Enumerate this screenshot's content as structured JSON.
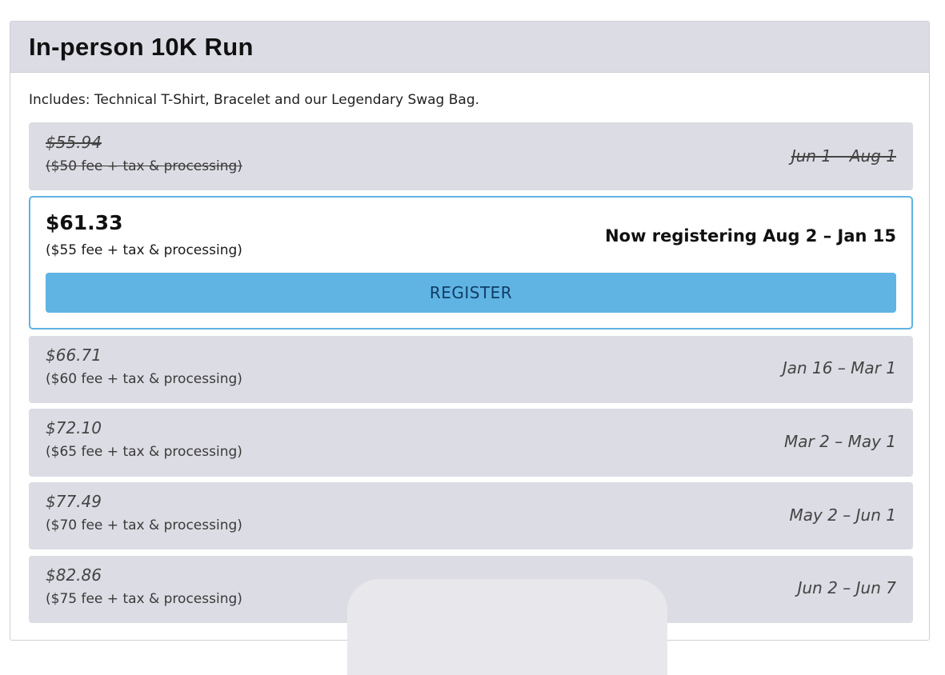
{
  "event": {
    "title": "In-person 10K Run",
    "includes": "Includes: Technical T-Shirt, Bracelet and our Legendary Swag Bag."
  },
  "tiers": [
    {
      "price": "$55.94",
      "fee": "($50 fee + tax & processing)",
      "dates": "Jun 1 – Aug 1",
      "status": "past"
    },
    {
      "price": "$61.33",
      "fee": "($55 fee + tax & processing)",
      "dates": "Now registering Aug 2 – Jan 15",
      "status": "current"
    },
    {
      "price": "$66.71",
      "fee": "($60 fee + tax & processing)",
      "dates": "Jan 16 – Mar 1",
      "status": "upcoming"
    },
    {
      "price": "$72.10",
      "fee": "($65 fee + tax & processing)",
      "dates": "Mar 2 – May 1",
      "status": "upcoming"
    },
    {
      "price": "$77.49",
      "fee": "($70 fee + tax & processing)",
      "dates": "May 2 – Jun 1",
      "status": "upcoming"
    },
    {
      "price": "$82.86",
      "fee": "($75 fee + tax & processing)",
      "dates": "Jun 2 – Jun 7",
      "status": "upcoming"
    }
  ],
  "register_button": {
    "label": "REGISTER"
  },
  "colors": {
    "header_bg": "#dcdce4",
    "tier_bg": "#dcdce4",
    "accent": "#60b4e3",
    "accent_border": "#5fb4e2",
    "button_text": "#0f3d66"
  }
}
